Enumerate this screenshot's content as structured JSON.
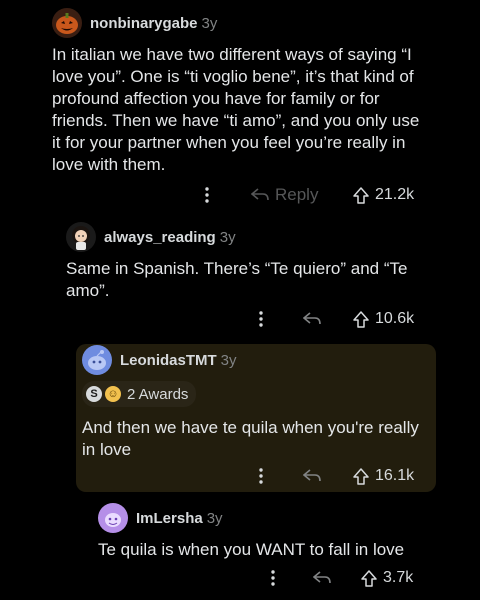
{
  "comments": [
    {
      "username": "nonbinarygabe",
      "age": "3y",
      "body": "In italian we have two different ways of saying “I love you”. One is “ti voglio bene”, it’s that kind of profound affection you have for family or for friends. Then we have “ti amo”, and you only use it for your partner when you feel you’re really in love with them.",
      "reply_label": "Reply",
      "votes": "21.2k"
    },
    {
      "username": "always_reading",
      "age": "3y",
      "body": "Same in Spanish. There’s  “Te quiero” and “Te amo”.",
      "votes": "10.6k"
    },
    {
      "username": "LeonidasTMT",
      "age": "3y",
      "awards": "2 Awards",
      "body": "And then we have te quila when you're really in love",
      "votes": "16.1k"
    },
    {
      "username": "ImLersha",
      "age": "3y",
      "body": "Te quila is when you WANT to fall in love",
      "votes": "3.7k"
    }
  ],
  "colors": {
    "background": "#000000",
    "highlight": "#221d0d",
    "text": "#e4e6e8",
    "muted": "#818384"
  }
}
